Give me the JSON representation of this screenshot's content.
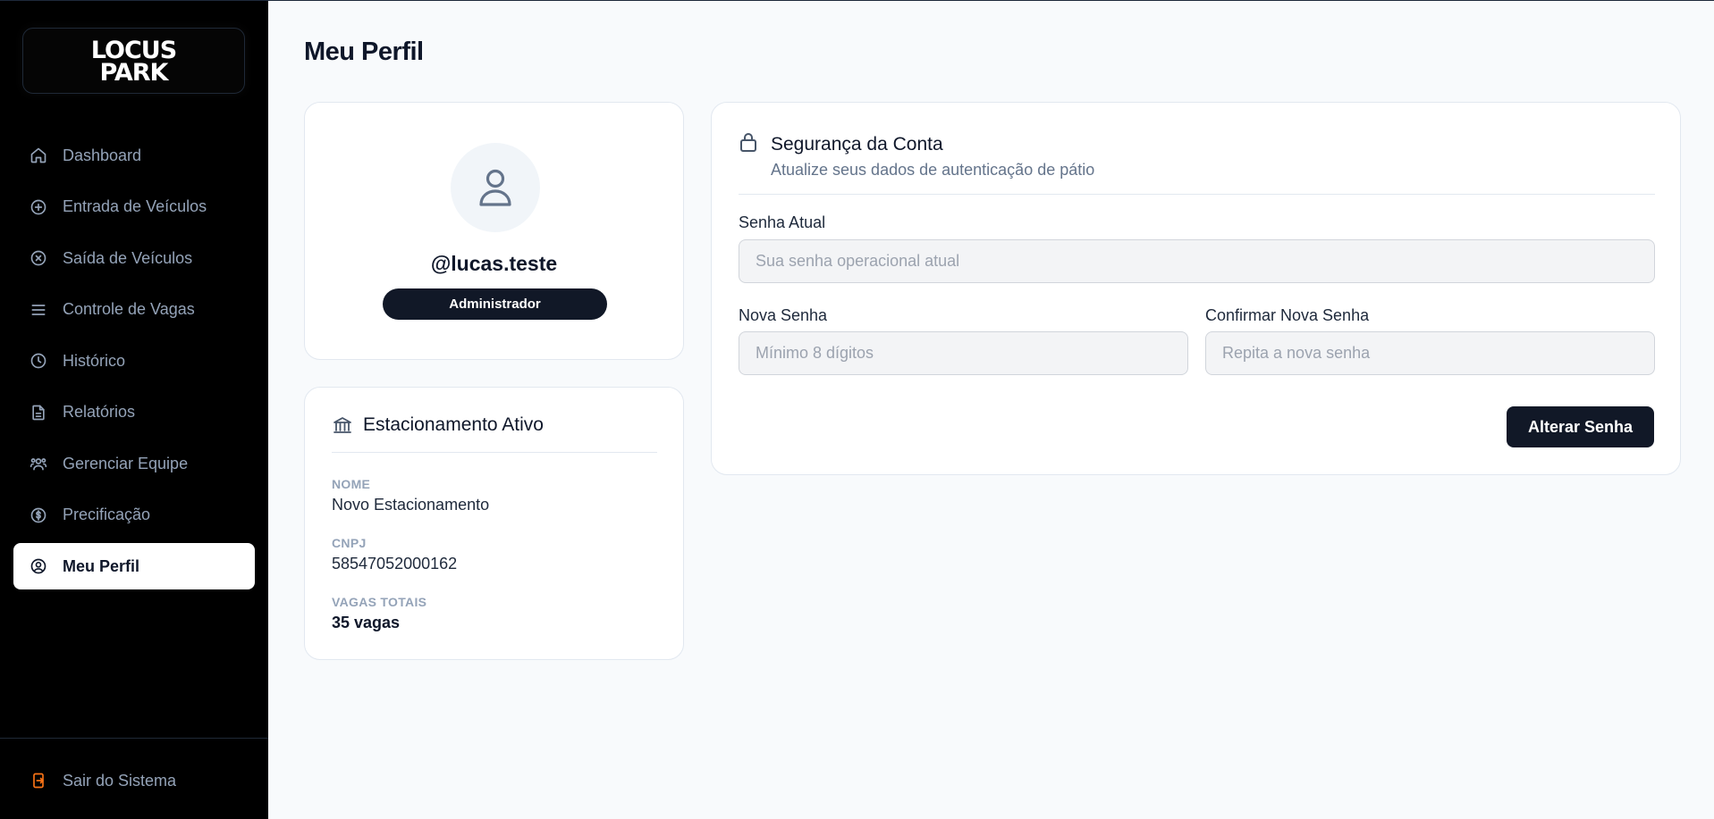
{
  "brand": {
    "line1": "LOCUS",
    "line2": "PARK"
  },
  "sidebar": {
    "items": [
      {
        "label": "Dashboard",
        "icon": "home-icon"
      },
      {
        "label": "Entrada de Veículos",
        "icon": "plus-circle-icon"
      },
      {
        "label": "Saída de Veículos",
        "icon": "x-circle-icon"
      },
      {
        "label": "Controle de Vagas",
        "icon": "menu-icon"
      },
      {
        "label": "Histórico",
        "icon": "clock-icon"
      },
      {
        "label": "Relatórios",
        "icon": "file-text-icon"
      },
      {
        "label": "Gerenciar Equipe",
        "icon": "users-icon"
      },
      {
        "label": "Precificação",
        "icon": "dollar-circle-icon"
      },
      {
        "label": "Meu Perfil",
        "icon": "user-circle-icon",
        "active": true
      }
    ],
    "logout_label": "Sair do Sistema"
  },
  "page": {
    "title": "Meu Perfil"
  },
  "profile": {
    "username": "@lucas.teste",
    "role": "Administrador"
  },
  "parking": {
    "title": "Estacionamento Ativo",
    "name_label": "NOME",
    "name_value": "Novo Estacionamento",
    "cnpj_label": "CNPJ",
    "cnpj_value": "58547052000162",
    "spots_label": "VAGAS TOTAIS",
    "spots_value": "35 vagas"
  },
  "security": {
    "title": "Segurança da Conta",
    "subtitle": "Atualize seus dados de autenticação de pátio",
    "current_label": "Senha Atual",
    "current_placeholder": "Sua senha operacional atual",
    "new_label": "Nova Senha",
    "new_placeholder": "Mínimo 8 dígitos",
    "confirm_label": "Confirmar Nova Senha",
    "confirm_placeholder": "Repita a nova senha",
    "submit_label": "Alterar Senha"
  },
  "colors": {
    "sidebar_bg": "#000000",
    "accent_dark": "#111827",
    "logout_icon": "#f97316"
  }
}
